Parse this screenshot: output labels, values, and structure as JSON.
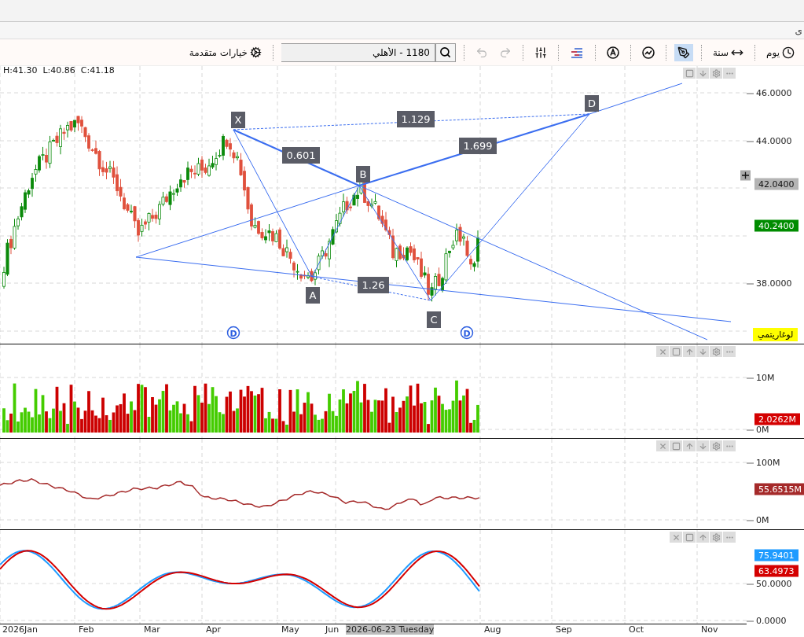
{
  "window": {
    "title": "ى"
  },
  "toolbar": {
    "period": {
      "label": "يوم"
    },
    "range": {
      "label": "سنة"
    },
    "tools": [
      {
        "kind": "draw",
        "selected": true
      },
      {
        "kind": "indicator",
        "selected": false
      },
      {
        "kind": "annotate",
        "selected": false
      },
      {
        "kind": "levels",
        "selected": false
      },
      {
        "kind": "compare",
        "selected": false
      }
    ],
    "history": [
      {
        "kind": "redo",
        "disabled": true
      },
      {
        "kind": "undo",
        "disabled": true
      }
    ],
    "symbol_search": {
      "value": "1180 - الأهلي"
    },
    "advanced_options": {
      "label": "خيارات متقدمة"
    }
  },
  "ohlc": [
    "H:41.30",
    "L:40.86",
    "C:41.18"
  ],
  "price_pane": {
    "ticks": [
      "46.0000",
      "44.0000",
      "38.0000"
    ],
    "badges": [
      {
        "text": "42.0400",
        "color": "#b4b4b4"
      },
      {
        "text": "40.2400",
        "color": "#008c00"
      }
    ],
    "scale_mode": "لوغاريتمي",
    "pattern_points": [
      "X",
      "A",
      "B",
      "C",
      "D"
    ],
    "ratios": [
      "0.601",
      "1.129",
      "1.699",
      "1.26"
    ],
    "event_markers": [
      "D",
      "D"
    ]
  },
  "volume_pane": {
    "ticks": [
      "10M",
      "0M"
    ],
    "badges": [
      {
        "text": "2.0262M",
        "color": "#d40000"
      }
    ]
  },
  "flow_pane": {
    "ticks": [
      "100M",
      "0M"
    ],
    "badges": [
      {
        "text": "55.6515M",
        "color": "#a52a2a"
      }
    ]
  },
  "stochastic_pane": {
    "ticks": [
      "50.0000",
      "0.0000"
    ],
    "badges": [
      {
        "text": "75.9401",
        "color": "#1e9bff"
      },
      {
        "text": "63.4973",
        "color": "#d40000"
      }
    ]
  },
  "x_axis": {
    "labels": [
      "2026Jan",
      "Feb",
      "Mar",
      "Apr",
      "May",
      "Jun",
      "Aug",
      "Sep",
      "Oct",
      "Nov"
    ],
    "crosshair_date": "2026-06-23 Tuesday"
  }
}
